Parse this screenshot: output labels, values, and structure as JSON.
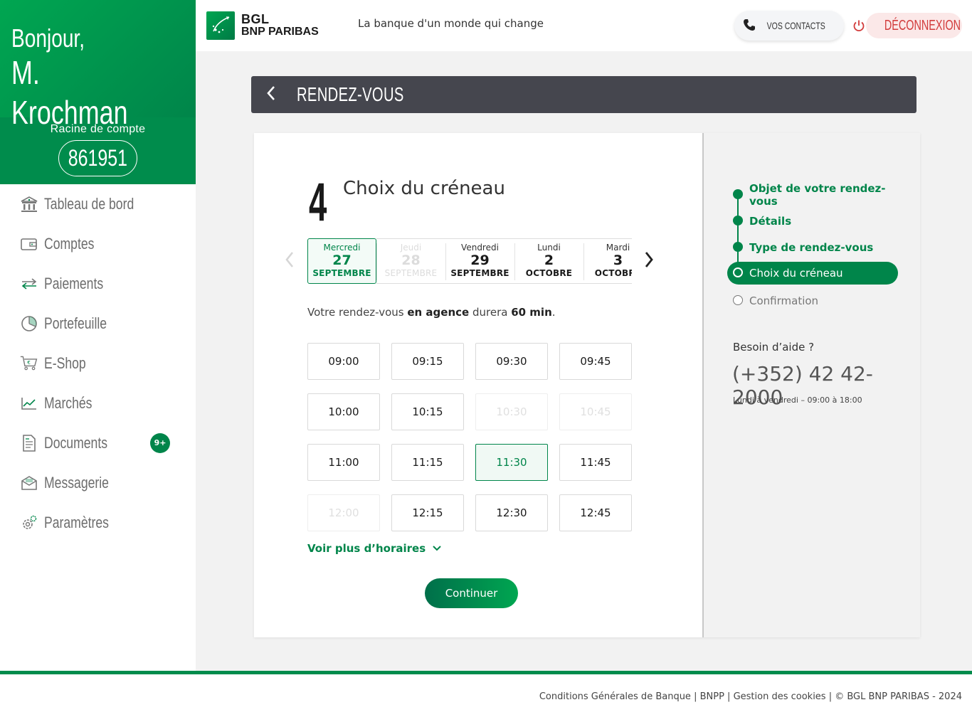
{
  "greeting": {
    "line1": "Bonjour,",
    "line2": "M. Krochman"
  },
  "account": {
    "label": "Racine de compte",
    "number": "861951"
  },
  "nav": [
    {
      "label": "Tableau de bord",
      "icon": "bank-icon"
    },
    {
      "label": "Comptes",
      "icon": "wallet-icon"
    },
    {
      "label": "Paiements",
      "icon": "transfer-icon"
    },
    {
      "label": "Portefeuille",
      "icon": "pie-chart-icon"
    },
    {
      "label": "E-Shop",
      "icon": "cart-icon"
    },
    {
      "label": "Marchés",
      "icon": "line-chart-icon"
    },
    {
      "label": "Documents",
      "icon": "document-icon",
      "badge": "9+"
    },
    {
      "label": "Messagerie",
      "icon": "mail-icon"
    },
    {
      "label": "Paramètres",
      "icon": "gear-icon"
    }
  ],
  "header": {
    "logo_line1": "BGL",
    "logo_line2": "BNP PARIBAS",
    "tagline": "La banque d'un monde qui change",
    "contacts_label": "VOS CONTACTS",
    "logout_label": "DÉCONNEXION"
  },
  "page": {
    "title": "RENDEZ-VOUS"
  },
  "step": {
    "number": "4",
    "title": "Choix du créneau"
  },
  "dates": [
    {
      "day": "Mercredi",
      "num": "27",
      "month": "SEPTEMBRE",
      "state": "selected"
    },
    {
      "day": "Jeudi",
      "num": "28",
      "month": "SEPTEMBRE",
      "state": "disabled"
    },
    {
      "day": "Vendredi",
      "num": "29",
      "month": "SEPTEMBRE",
      "state": "available"
    },
    {
      "day": "Lundi",
      "num": "2",
      "month": "OCTOBRE",
      "state": "available"
    },
    {
      "day": "Mardi",
      "num": "3",
      "month": "OCTOBRE",
      "state": "available"
    }
  ],
  "duration": {
    "pre": "Votre rendez-vous ",
    "mode": "en agence",
    "mid": " durera ",
    "length": "60 min",
    "post": "."
  },
  "slots": [
    {
      "time": "09:00",
      "state": "available"
    },
    {
      "time": "09:15",
      "state": "available"
    },
    {
      "time": "09:30",
      "state": "available"
    },
    {
      "time": "09:45",
      "state": "available"
    },
    {
      "time": "10:00",
      "state": "available"
    },
    {
      "time": "10:15",
      "state": "available"
    },
    {
      "time": "10:30",
      "state": "disabled"
    },
    {
      "time": "10:45",
      "state": "disabled"
    },
    {
      "time": "11:00",
      "state": "available"
    },
    {
      "time": "11:15",
      "state": "available"
    },
    {
      "time": "11:30",
      "state": "selected"
    },
    {
      "time": "11:45",
      "state": "available"
    },
    {
      "time": "12:00",
      "state": "disabled"
    },
    {
      "time": "12:15",
      "state": "available"
    },
    {
      "time": "12:30",
      "state": "available"
    },
    {
      "time": "12:45",
      "state": "available"
    }
  ],
  "more_label": "Voir plus d’horaires",
  "continue_label": "Continuer",
  "stepper": [
    {
      "label": "Objet de votre rendez-vous",
      "state": "done"
    },
    {
      "label": "Détails",
      "state": "done"
    },
    {
      "label": "Type de rendez-vous",
      "state": "done"
    },
    {
      "label": "Choix du créneau",
      "state": "current"
    },
    {
      "label": "Confirmation",
      "state": "todo"
    }
  ],
  "help": {
    "title": "Besoin d’aide ?",
    "phone": "(+352) 42 42-2000",
    "hours": "Lundi à vendredi – 09:00 à 18:00"
  },
  "footer": {
    "links": [
      "Conditions Générales de Banque",
      "BNPP",
      "Gestion des cookies",
      "© BGL BNP PARIBAS - 2024"
    ]
  },
  "colors": {
    "brand": "#00854a",
    "danger": "#d23b3b",
    "titlebar": "#45464e"
  }
}
